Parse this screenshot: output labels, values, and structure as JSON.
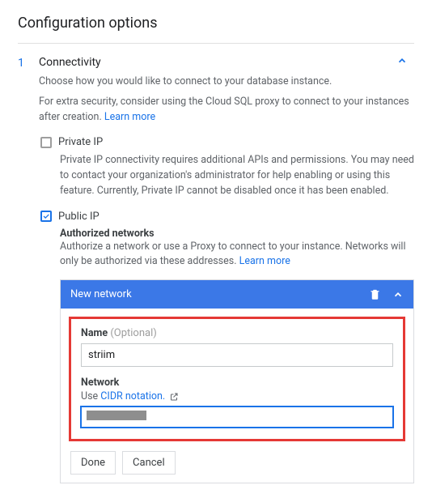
{
  "page_title": "Configuration options",
  "section": {
    "step": "1",
    "title": "Connectivity",
    "desc1": "Choose how you would like to connect to your database instance.",
    "desc2_pre": "For extra security, consider using the Cloud SQL proxy to connect to your instances after creation. ",
    "learn_more": "Learn more"
  },
  "private_ip": {
    "label": "Private IP",
    "desc": "Private IP connectivity requires additional APIs and permissions. You may need to contact your organization's administrator for help enabling or using this feature. Currently, Private IP cannot be disabled once it has been enabled.",
    "checked": false
  },
  "public_ip": {
    "label": "Public IP",
    "checked": true,
    "auth_heading": "Authorized networks",
    "auth_desc_pre": "Authorize a network or use a Proxy to connect to your instance. Networks will only be authorized via these addresses. ",
    "learn_more": "Learn more"
  },
  "network_card": {
    "header": "New network",
    "name_label": "Name",
    "name_optional": "(Optional)",
    "name_value": "striim",
    "network_label": "Network",
    "network_hint_pre": "Use ",
    "network_hint_link": "CIDR notation.",
    "network_value": ""
  },
  "buttons": {
    "done": "Done",
    "cancel": "Cancel"
  }
}
